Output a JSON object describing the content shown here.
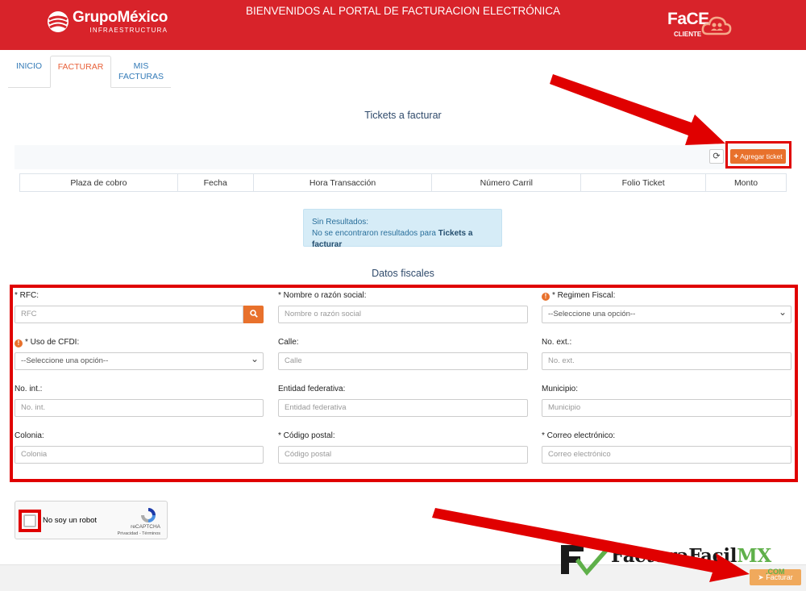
{
  "header": {
    "logo_brand": "GrupoMéxico",
    "logo_sub": "INFRAESTRUCTURA",
    "title": "BIENVENIDOS AL PORTAL DE FACTURACION ELECTRÓNICA",
    "face_title": "FaCE",
    "face_sub": "CLIENTE"
  },
  "tabs": [
    {
      "label": "INICIO"
    },
    {
      "label": "FACTURAR",
      "active": true
    },
    {
      "label": "MIS FACTURAS"
    }
  ],
  "tickets": {
    "title": "Tickets a facturar",
    "refresh_icon": "refresh-icon",
    "add_button": "Agregar ticket",
    "columns": [
      "Plaza de cobro",
      "Fecha",
      "Hora Transacción",
      "Número Carril",
      "Folio Ticket",
      "Monto"
    ],
    "empty_title": "Sin Resultados:",
    "empty_message": "No se encontraron resultados para",
    "empty_strong": "Tickets a facturar"
  },
  "fiscal": {
    "title": "Datos fiscales",
    "rfc": {
      "label": "* RFC:",
      "placeholder": "RFC"
    },
    "razon_social": {
      "label": "* Nombre o razón social:",
      "placeholder": "Nombre o razón social"
    },
    "regimen": {
      "label": "* Regimen Fiscal:",
      "value": "--Seleccione una opción--"
    },
    "uso_cfdi": {
      "label": "* Uso de CFDI:",
      "value": "--Seleccione una opción--"
    },
    "calle": {
      "label": "Calle:",
      "placeholder": "Calle"
    },
    "no_ext": {
      "label": "No. ext.:",
      "placeholder": "No. ext."
    },
    "no_int": {
      "label": "No. int.:",
      "placeholder": "No. int."
    },
    "entidad": {
      "label": "Entidad federativa:",
      "placeholder": "Entidad federativa"
    },
    "municipio": {
      "label": "Municipio:",
      "placeholder": "Municipio"
    },
    "colonia": {
      "label": "Colonia:",
      "placeholder": "Colonia"
    },
    "codigo_postal": {
      "label": "* Código postal:",
      "placeholder": "Código postal"
    },
    "correo": {
      "label": "* Correo electrónico:",
      "placeholder": "Correo electrónico"
    }
  },
  "captcha": {
    "label": "No soy un robot",
    "brand": "reCAPTCHA",
    "terms": "Privacidad - Términos"
  },
  "footer": {
    "submit_button": "Facturar"
  },
  "watermark": {
    "text_main": "FacturaFacil",
    "text_mx": "MX",
    "text_com": ".COM"
  },
  "colors": {
    "header_red": "#d8232a",
    "accent_orange": "#e8712c",
    "highlight_red": "#e00000"
  }
}
